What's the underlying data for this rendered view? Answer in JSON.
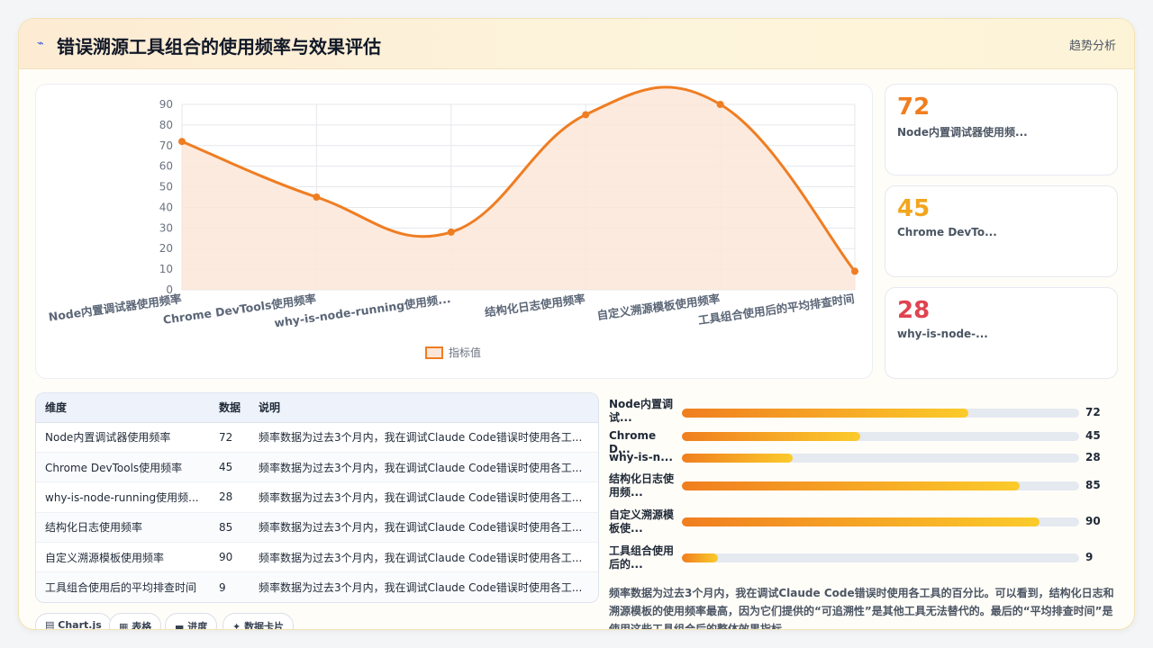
{
  "header": {
    "icon": "pulse-icon",
    "title": "错误溯源工具组合的使用频率与效果评估",
    "trend_label": "趋势分析"
  },
  "chart_data": {
    "type": "area",
    "categories": [
      "Node内置调试器使用频率",
      "Chrome DevTools使用频率",
      "why-is-node-running使用频...",
      "结构化日志使用频率",
      "自定义溯源模板使用频率",
      "工具组合使用后的平均排查时间"
    ],
    "series": [
      {
        "name": "指标值",
        "values": [
          72,
          45,
          28,
          85,
          90,
          9
        ]
      }
    ],
    "ylim": [
      0,
      90
    ],
    "yticks": [
      0,
      10,
      20,
      30,
      40,
      50,
      60,
      70,
      80,
      90
    ],
    "grid": true,
    "legend": "bottom",
    "colors": {
      "line": "#ef7d22",
      "fill": "#fbe6d8"
    }
  },
  "stats": [
    {
      "value": "72",
      "label": "Node内置调试器使用频...",
      "color": "#f07e1f"
    },
    {
      "value": "45",
      "label": "Chrome DevTo...",
      "color": "#f2a51c"
    },
    {
      "value": "28",
      "label": "why-is-node-...",
      "color": "#e0434f"
    }
  ],
  "table": {
    "headers": [
      "维度",
      "数据",
      "说明"
    ],
    "rows": [
      [
        "Node内置调试器使用频率",
        "72",
        "频率数据为过去3个月内，我在调试Claude Code错误时使用各工..."
      ],
      [
        "Chrome DevTools使用频率",
        "45",
        "频率数据为过去3个月内，我在调试Claude Code错误时使用各工..."
      ],
      [
        "why-is-node-running使用频...",
        "28",
        "频率数据为过去3个月内，我在调试Claude Code错误时使用各工..."
      ],
      [
        "结构化日志使用频率",
        "85",
        "频率数据为过去3个月内，我在调试Claude Code错误时使用各工..."
      ],
      [
        "自定义溯源模板使用频率",
        "90",
        "频率数据为过去3个月内，我在调试Claude Code错误时使用各工..."
      ],
      [
        "工具组合使用后的平均排查时间",
        "9",
        "频率数据为过去3个月内，我在调试Claude Code错误时使用各工..."
      ]
    ]
  },
  "progress": [
    {
      "label": "Node内置调试...",
      "value": 72,
      "display": "72"
    },
    {
      "label": "Chrome D...",
      "value": 45,
      "display": "45"
    },
    {
      "label": "why-is-n...",
      "value": 28,
      "display": "28"
    },
    {
      "label": "结构化日志使用频...",
      "value": 85,
      "display": "85"
    },
    {
      "label": "自定义溯源模板使...",
      "value": 90,
      "display": "90"
    },
    {
      "label": "工具组合使用后的...",
      "value": 9,
      "display": "9"
    }
  ],
  "description": "频率数据为过去3个月内，我在调试Claude Code错误时使用各工具的百分比。可以看到，结构化日志和溯源模板的使用频率最高，因为它们提供的“可追溯性”是其他工具无法替代的。最后的“平均排查时间”是使用这些工具组合后的整体效果指标。",
  "tabs": [
    {
      "icon": "bar-chart-icon",
      "label": "Chart.js"
    },
    {
      "icon": "table-icon",
      "label": "表格"
    },
    {
      "icon": "progress-icon",
      "label": "进度"
    },
    {
      "icon": "sparkle-icon",
      "label": "数据卡片"
    }
  ]
}
